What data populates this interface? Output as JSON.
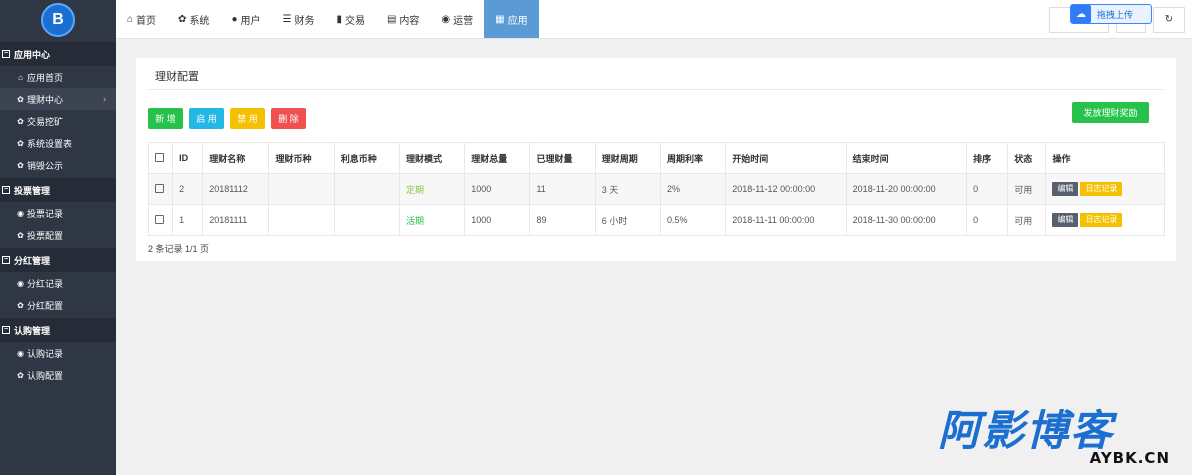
{
  "sidebar": {
    "logo_text": "B",
    "groups": [
      {
        "title": "应用中心",
        "items": [
          {
            "icon": "home-icon",
            "glyph": "⌂",
            "label": "应用首页"
          },
          {
            "icon": "gear-icon",
            "glyph": "✿",
            "label": "理财中心",
            "active": true
          },
          {
            "icon": "gear-icon",
            "glyph": "✿",
            "label": "交易挖矿"
          },
          {
            "icon": "gear-icon",
            "glyph": "✿",
            "label": "系统设置表"
          },
          {
            "icon": "gear-icon",
            "glyph": "✿",
            "label": "销毁公示"
          }
        ]
      },
      {
        "title": "投票管理",
        "items": [
          {
            "icon": "globe-icon",
            "glyph": "◉",
            "label": "投票记录"
          },
          {
            "icon": "gear-icon",
            "glyph": "✿",
            "label": "投票配置"
          }
        ]
      },
      {
        "title": "分红管理",
        "items": [
          {
            "icon": "globe-icon",
            "glyph": "◉",
            "label": "分红记录"
          },
          {
            "icon": "gear-icon",
            "glyph": "✿",
            "label": "分红配置"
          }
        ]
      },
      {
        "title": "认购管理",
        "items": [
          {
            "icon": "globe-icon",
            "glyph": "◉",
            "label": "认购记录"
          },
          {
            "icon": "gear-icon",
            "glyph": "✿",
            "label": "认购配置"
          }
        ]
      }
    ]
  },
  "topnav": {
    "tabs": [
      {
        "icon": "home-icon",
        "glyph": "⌂",
        "label": "首页"
      },
      {
        "icon": "gear-icon",
        "glyph": "✿",
        "label": "系统"
      },
      {
        "icon": "user-icon",
        "glyph": "●",
        "label": "用户"
      },
      {
        "icon": "list-icon",
        "glyph": "☰",
        "label": "财务"
      },
      {
        "icon": "bar-chart-icon",
        "glyph": "▮",
        "label": "交易"
      },
      {
        "icon": "file-icon",
        "glyph": "▤",
        "label": "内容"
      },
      {
        "icon": "globe-icon",
        "glyph": "◉",
        "label": "运营"
      },
      {
        "icon": "grid-icon",
        "glyph": "▦",
        "label": "应用",
        "active": true
      }
    ],
    "upload_label": "拖拽上传",
    "refresh_glyph": "↻"
  },
  "panel": {
    "title": "理财配置",
    "buttons": {
      "add": "新 增",
      "enable": "启 用",
      "disable": "禁 用",
      "delete": "删 除",
      "reward": "发放理财奖励"
    },
    "columns": [
      "",
      "ID",
      "理财名称",
      "理财币种",
      "利息币种",
      "理财模式",
      "理财总量",
      "已理财量",
      "理财周期",
      "周期利率",
      "开始时间",
      "结束时间",
      "排序",
      "状态",
      "操作"
    ],
    "rows": [
      {
        "id": "2",
        "name": "20181112",
        "coin": "",
        "interest_coin": "",
        "mode": "定期",
        "total": "1000",
        "done": "11",
        "period": "3 天",
        "rate": "2%",
        "start": "2018-11-12 00:00:00",
        "end": "2018-11-20 00:00:00",
        "sort": "0",
        "status": "可用",
        "edit": "编辑",
        "log": "日志记录"
      },
      {
        "id": "1",
        "name": "20181111",
        "coin": "",
        "interest_coin": "",
        "mode": "活期",
        "total": "1000",
        "done": "89",
        "period": "6 小时",
        "rate": "0.5%",
        "start": "2018-11-11 00:00:00",
        "end": "2018-11-30 00:00:00",
        "sort": "0",
        "status": "可用",
        "edit": "编辑",
        "log": "日志记录"
      }
    ],
    "footer": "2 条记录 1/1 页"
  },
  "watermark": {
    "main": "阿影博客",
    "sub": "AYBK.CN"
  }
}
